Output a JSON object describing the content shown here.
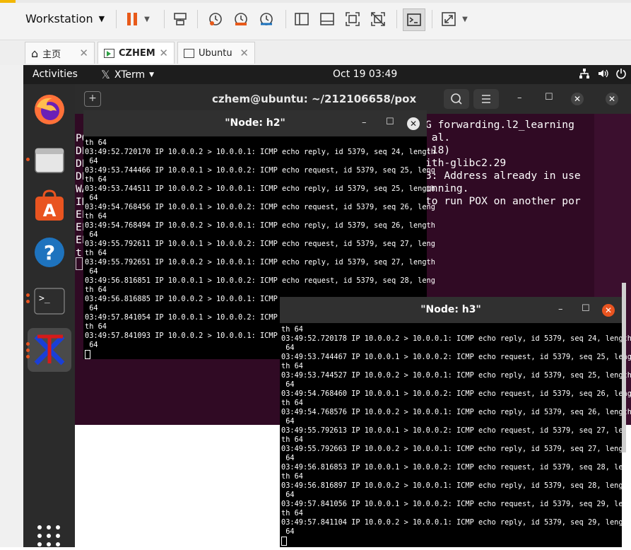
{
  "host": {
    "menu_label": "Workstation",
    "tabs": [
      {
        "label": "主页"
      },
      {
        "label": "CZHEM"
      },
      {
        "label": "Ubuntu"
      }
    ]
  },
  "topbar": {
    "activities": "Activities",
    "app": "XTerm",
    "clock": "Oct 19  03:49"
  },
  "bg_terminal": {
    "title": "czhem@ubuntu: ~/212106658/pox",
    "right_lines": [
      "G forwarding.l2_learning",
      " al.",
      "",
      ":18)",
      "ith-glibc2.29",
      "",
      "3: Address already in use",
      "unning.",
      "to run POX on another por"
    ],
    "left_chars": [
      "PO",
      "DE",
      "DE",
      "DE",
      "WA",
      "IN",
      "EF",
      "EF",
      "EF",
      "t"
    ],
    "accent": "#300a24"
  },
  "h2": {
    "title": "\"Node: h2\"",
    "lines": [
      "th 64",
      "03:49:52.720170 IP 10.0.0.2 > 10.0.0.1: ICMP echo reply, id 5379, seq 24, length",
      " 64",
      "03:49:53.744466 IP 10.0.0.1 > 10.0.0.2: ICMP echo request, id 5379, seq 25, leng",
      "th 64",
      "03:49:53.744511 IP 10.0.0.2 > 10.0.0.1: ICMP echo reply, id 5379, seq 25, length",
      " 64",
      "03:49:54.768456 IP 10.0.0.1 > 10.0.0.2: ICMP echo request, id 5379, seq 26, leng",
      "th 64",
      "03:49:54.768494 IP 10.0.0.2 > 10.0.0.1: ICMP echo reply, id 5379, seq 26, length",
      " 64",
      "03:49:55.792611 IP 10.0.0.1 > 10.0.0.2: ICMP echo request, id 5379, seq 27, leng",
      "th 64",
      "03:49:55.792651 IP 10.0.0.2 > 10.0.0.1: ICMP echo reply, id 5379, seq 27, length",
      " 64",
      "03:49:56.816851 IP 10.0.0.1 > 10.0.0.2: ICMP echo request, id 5379, seq 28, leng",
      "th 64",
      "03:49:56.816885 IP 10.0.0.2 > 10.0.0.1: ICMP e",
      " 64",
      "03:49:57.841054 IP 10.0.0.1 > 10.0.0.2: ICMP e",
      "th 64",
      "03:49:57.841093 IP 10.0.0.2 > 10.0.0.1: ICMP e",
      " 64"
    ]
  },
  "h3": {
    "title": "\"Node: h3\"",
    "lines": [
      "th 64",
      "03:49:52.720178 IP 10.0.0.2 > 10.0.0.1: ICMP echo reply, id 5379, seq 24, length",
      " 64",
      "03:49:53.744467 IP 10.0.0.1 > 10.0.0.2: ICMP echo request, id 5379, seq 25, leng",
      "th 64",
      "03:49:53.744527 IP 10.0.0.2 > 10.0.0.1: ICMP echo reply, id 5379, seq 25, length",
      " 64",
      "03:49:54.768460 IP 10.0.0.1 > 10.0.0.2: ICMP echo request, id 5379, seq 26, leng",
      "th 64",
      "03:49:54.768576 IP 10.0.0.2 > 10.0.0.1: ICMP echo reply, id 5379, seq 26, length",
      " 64",
      "03:49:55.792613 IP 10.0.0.1 > 10.0.0.2: ICMP echo request, id 5379, seq 27, leng",
      "th 64",
      "03:49:55.792663 IP 10.0.0.2 > 10.0.0.1: ICMP echo reply, id 5379, seq 27, length",
      " 64",
      "03:49:56.816853 IP 10.0.0.1 > 10.0.0.2: ICMP echo request, id 5379, seq 28, leng",
      "th 64",
      "03:49:56.816897 IP 10.0.0.2 > 10.0.0.1: ICMP echo reply, id 5379, seq 28, length",
      " 64",
      "03:49:57.841056 IP 10.0.0.1 > 10.0.0.2: ICMP echo request, id 5379, seq 29, leng",
      "th 64",
      "03:49:57.841104 IP 10.0.0.2 > 10.0.0.1: ICMP echo reply, id 5379, seq 29, length",
      " 64"
    ]
  }
}
